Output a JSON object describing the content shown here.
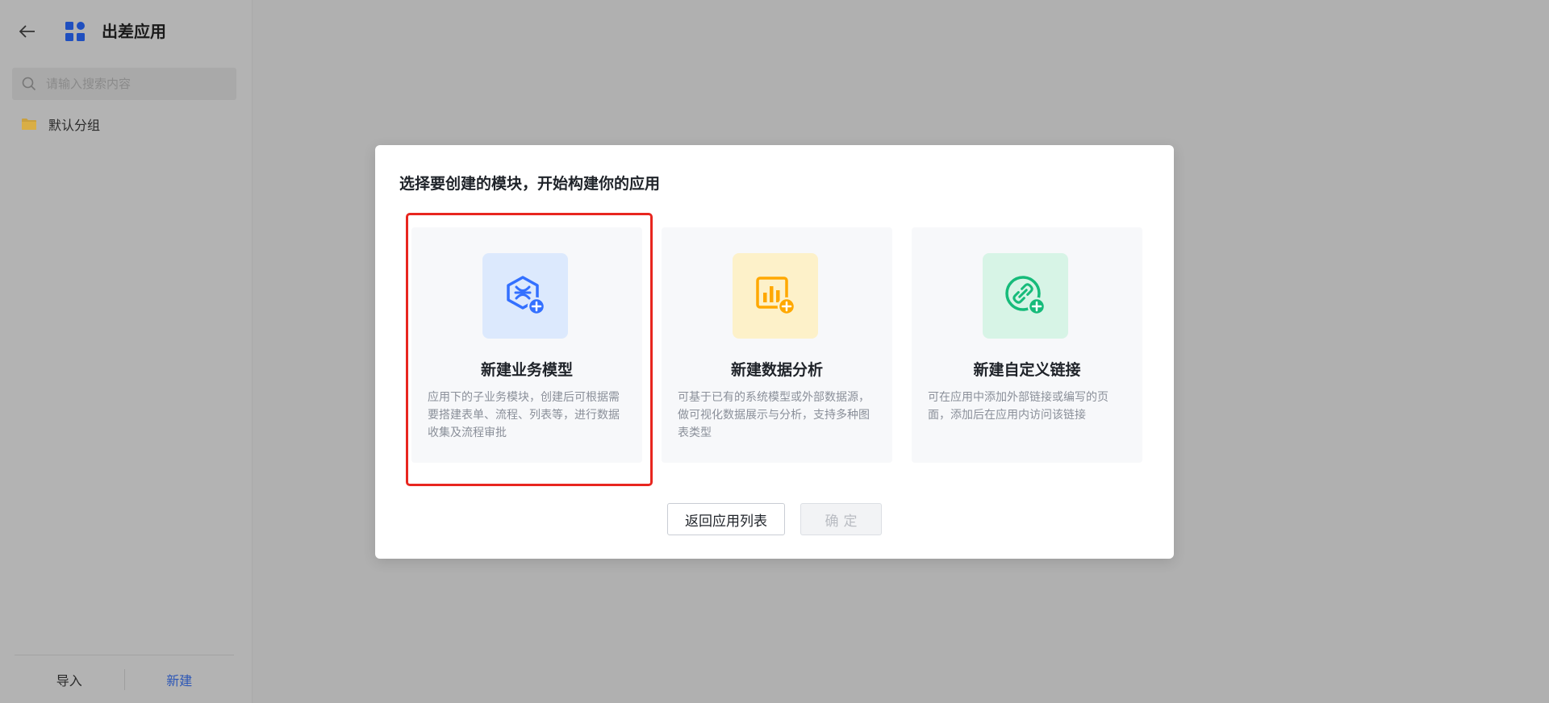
{
  "sidebar": {
    "app_title": "出差应用",
    "search_placeholder": "请输入搜索内容",
    "groups": [
      {
        "label": "默认分组"
      }
    ],
    "footer": {
      "import_label": "导入",
      "create_label": "新建"
    }
  },
  "modal": {
    "title": "选择要创建的模块，开始构建你的应用",
    "cards": [
      {
        "title": "新建业务模型",
        "description": "应用下的子业务模块，创建后可根据需要搭建表单、流程、列表等，进行数据收集及流程审批",
        "icon": "business-model-icon",
        "icon_bg": "#dce9fd",
        "icon_color": "#3370ff",
        "selected": true
      },
      {
        "title": "新建数据分析",
        "description": "可基于已有的系统模型或外部数据源，做可视化数据展示与分析，支持多种图表类型",
        "icon": "data-analysis-icon",
        "icon_bg": "#fdf1c9",
        "icon_color": "#ffa800",
        "selected": false
      },
      {
        "title": "新建自定义链接",
        "description": "可在应用中添加外部链接或编写的页面，添加后在应用内访问该链接",
        "icon": "custom-link-icon",
        "icon_bg": "#d7f4e6",
        "icon_color": "#16bb7a",
        "selected": false
      }
    ],
    "back_button": "返回应用列表",
    "confirm_button": "确定"
  },
  "colors": {
    "overlay": "#b0b0b0",
    "highlight_border": "#e8261f",
    "link_blue": "#2d57b6"
  }
}
